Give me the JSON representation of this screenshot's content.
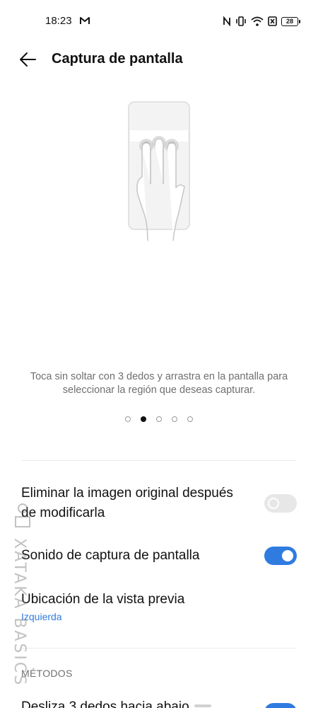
{
  "status_bar": {
    "time": "18:23",
    "battery": "28",
    "icons": [
      "gmail-icon",
      "nfc-icon",
      "vibrate-icon",
      "wifi-icon",
      "sim-x-icon",
      "battery-icon"
    ]
  },
  "header": {
    "title": "Captura de pantalla",
    "back_icon": "arrow-left-icon"
  },
  "illustration": {
    "icon": "three-finger-swipe-illustration"
  },
  "description": "Toca sin soltar con 3 dedos y arrastra en la pantalla para seleccionar la región que deseas capturar.",
  "pager": {
    "count": 5,
    "active_index": 1
  },
  "settings": [
    {
      "label": "Eliminar la imagen original después de modificarla",
      "toggle": false
    },
    {
      "label": "Sonido de captura de pantalla",
      "toggle": true
    },
    {
      "label": "Ubicación de la vista previa",
      "value": "Izquierda"
    }
  ],
  "sections": {
    "metodos": "MÉTODOS"
  },
  "partial_setting": {
    "label": "Desliza 3 dedos hacia abajo",
    "toggle": true
  },
  "watermark": "XATAKA BASICS",
  "colors": {
    "accent": "#2f7be0",
    "toggle_off": "#e7e7e7",
    "secondary_text": "#6f6f6f"
  }
}
